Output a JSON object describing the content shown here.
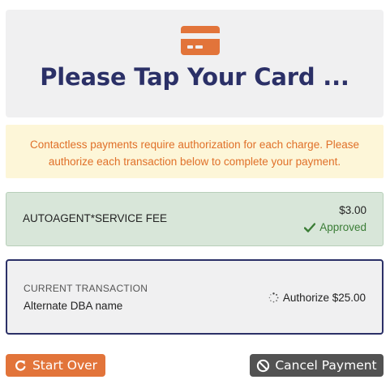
{
  "header": {
    "title": "Please Tap Your Card ...",
    "icon": "credit-card-icon",
    "icon_color": "#e2743a",
    "title_color": "#2b3067"
  },
  "notice": {
    "text": "Contactless payments require authorization for each charge. Please authorize each transaction below to complete your payment."
  },
  "approved_transaction": {
    "merchant": "AUTOAGENT*SERVICE FEE",
    "amount": "$3.00",
    "status": "Approved",
    "status_icon": "check-icon",
    "status_color": "#3b7d36"
  },
  "current_transaction": {
    "label": "CURRENT TRANSACTION",
    "merchant": "Alternate DBA name",
    "action": "Authorize $25.00",
    "action_icon": "spinner-icon"
  },
  "buttons": {
    "start_over": "Start Over",
    "start_over_icon": "restart-icon",
    "cancel_payment": "Cancel Payment",
    "cancel_payment_icon": "ban-icon"
  },
  "colors": {
    "accent": "#e2743a",
    "navy": "#2b3067",
    "notice_bg": "#fdf6d8",
    "approved_bg": "#d8e6d9",
    "cancel_bg": "#525252"
  }
}
